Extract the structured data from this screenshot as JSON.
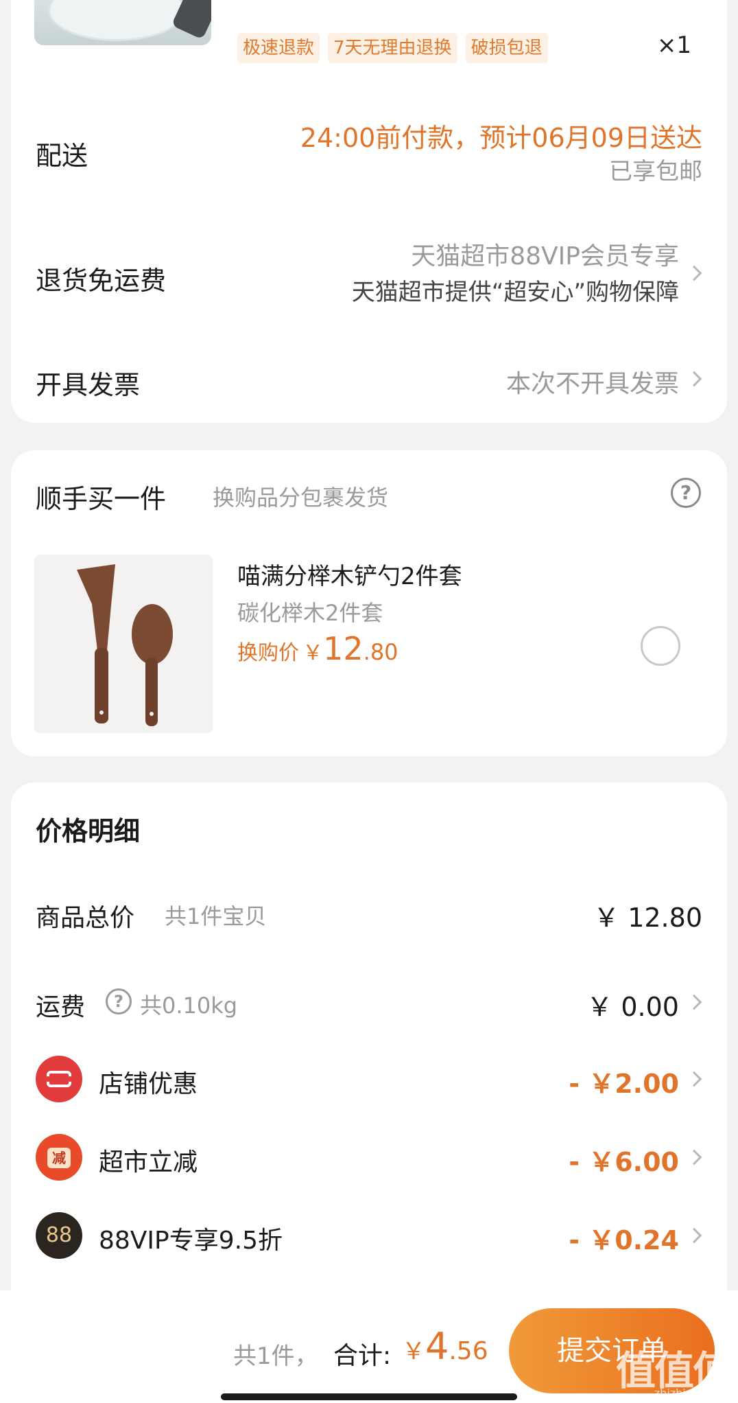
{
  "order_item": {
    "tags": [
      "极速退款",
      "7天无理由退换",
      "破损包退"
    ],
    "quantity": "×1"
  },
  "delivery": {
    "label": "配送",
    "eta": "24:00前付款，预计06月09日送达",
    "shipping": "已享包邮"
  },
  "return_shipping": {
    "label": "退货免运费",
    "line1": "天猫超市88VIP会员专享",
    "line2": "天猫超市提供“超安心”购物保障"
  },
  "invoice": {
    "label": "开具发票",
    "value": "本次不开具发票"
  },
  "addon": {
    "title": "顺手买一件",
    "subtitle": "换购品分包裹发货",
    "product_name": "喵满分榉木铲勺2件套",
    "product_spec": "碳化榉木2件套",
    "price_label": "换购价",
    "currency": "￥",
    "price_int": "12",
    "price_dec": ".80"
  },
  "price_detail": {
    "title": "价格明细",
    "goods_label": "商品总价",
    "goods_count": "共1件宝贝",
    "goods_value": "￥ 12.80",
    "freight_label": "运费",
    "freight_weight": "共0.10kg",
    "freight_value": "￥ 0.00",
    "store_discount_label": "店铺优惠",
    "store_discount_value": "- ￥2.00",
    "market_discount_label": "超市立减",
    "market_discount_icon": "减",
    "market_discount_value": "- ￥6.00",
    "vip_label": "88VIP专享9.5折",
    "vip_icon": "88",
    "vip_value": "- ￥0.24"
  },
  "footer": {
    "count": "共1件，",
    "total_label": "合计:",
    "currency": "￥",
    "total_int": "4",
    "total_dec": ".56",
    "submit": "提交订单",
    "watermark": "值值值",
    "watermark_url": "zhizhizhi.com"
  },
  "colors": {
    "accent": "#e0742a",
    "button_start": "#f09a3a",
    "button_end": "#ea6e1e",
    "store_icon": "#e23b3b",
    "market_icon": "#e94a2a",
    "vip_icon": "#2b2520"
  }
}
